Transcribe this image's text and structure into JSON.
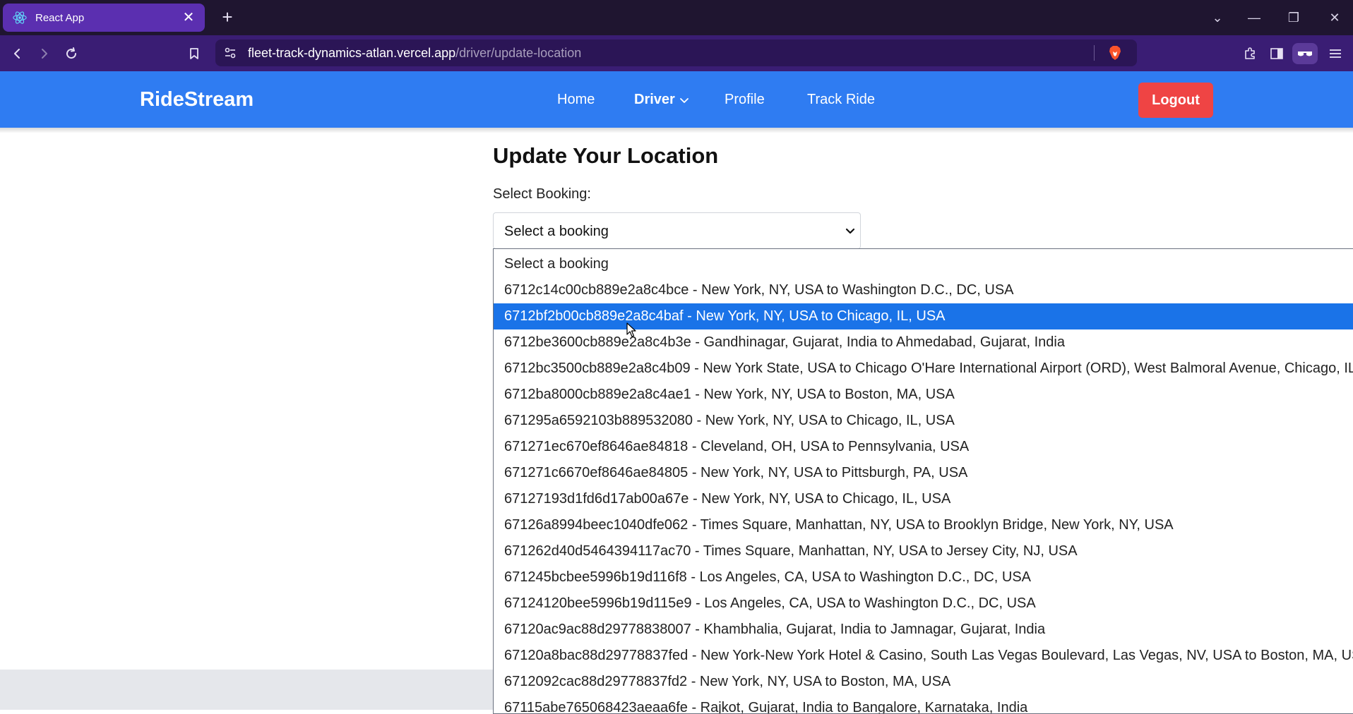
{
  "browser": {
    "tab_title": "React App",
    "url_host": "fleet-track-dynamics-atlan.vercel.app",
    "url_path": "/driver/update-location",
    "tab_close": "✕",
    "new_tab": "+",
    "window_buttons": [
      "⌄",
      "—",
      "❐",
      "✕"
    ]
  },
  "navbar": {
    "brand": "RideStream",
    "links": {
      "home": "Home",
      "driver": "Driver",
      "profile": "Profile",
      "track": "Track Ride"
    },
    "logout": "Logout",
    "colors": {
      "bar": "#2f7cf2",
      "logout": "#ef4444"
    }
  },
  "main": {
    "title": "Update Your Location",
    "booking_label": "Select Booking:",
    "booking_selected": "Select a booking"
  },
  "dropdown": {
    "selected_index": 2,
    "options": [
      "Select a booking",
      "6712c14c00cb889e2a8c4bce - New York, NY, USA to Washington D.C., DC, USA",
      "6712bf2b00cb889e2a8c4baf - New York, NY, USA to Chicago, IL, USA",
      "6712be3600cb889e2a8c4b3e - Gandhinagar, Gujarat, India to Ahmedabad, Gujarat, India",
      "6712bc3500cb889e2a8c4b09 - New York State, USA to Chicago O'Hare International Airport (ORD), West Balmoral Avenue, Chicago, IL, U",
      "6712ba8000cb889e2a8c4ae1 - New York, NY, USA to Boston, MA, USA",
      "671295a6592103b889532080 - New York, NY, USA to Chicago, IL, USA",
      "671271ec670ef8646ae84818 - Cleveland, OH, USA to Pennsylvania, USA",
      "671271c6670ef8646ae84805 - New York, NY, USA to Pittsburgh, PA, USA",
      "67127193d1fd6d17ab00a67e - New York, NY, USA to Chicago, IL, USA",
      "67126a8994beec1040dfe062 - Times Square, Manhattan, NY, USA to Brooklyn Bridge, New York, NY, USA",
      "671262d40d5464394117ac70 - Times Square, Manhattan, NY, USA to Jersey City, NJ, USA",
      "671245bcbee5996b19d116f8 - Los Angeles, CA, USA to Washington D.C., DC, USA",
      "67124120bee5996b19d115e9 - Los Angeles, CA, USA to Washington D.C., DC, USA",
      "67120ac9ac88d29778838007 - Khambhalia, Gujarat, India to Jamnagar, Gujarat, India",
      "67120a8bac88d29778837fed - New York-New York Hotel & Casino, South Las Vegas Boulevard, Las Vegas, NV, USA to Boston, MA, USA",
      "6712092cac88d29778837fd2 - New York, NY, USA to Boston, MA, USA",
      "67115abe765068423aeaa6fe - Rajkot, Gujarat, India to Bangalore, Karnataka, India"
    ]
  }
}
